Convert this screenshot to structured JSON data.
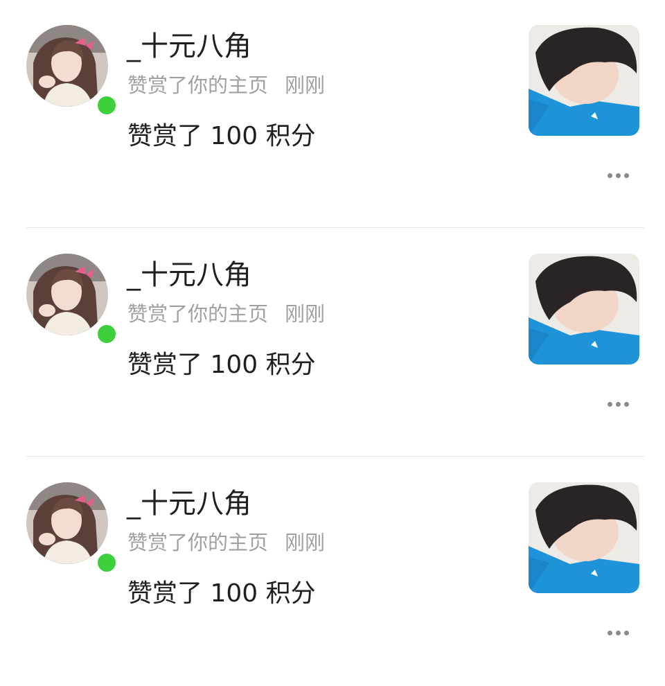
{
  "notifications": [
    {
      "username": "_十元八角",
      "action": "赞赏了你的主页",
      "time": "刚刚",
      "content": "赞赏了 100 积分",
      "avatar_icon": "user-avatar-photo",
      "thumbnail_icon": "profile-photo-thumbnail",
      "online_status_color": "#3ecf3c"
    },
    {
      "username": "_十元八角",
      "action": "赞赏了你的主页",
      "time": "刚刚",
      "content": "赞赏了 100 积分",
      "avatar_icon": "user-avatar-photo",
      "thumbnail_icon": "profile-photo-thumbnail",
      "online_status_color": "#3ecf3c"
    },
    {
      "username": "_十元八角",
      "action": "赞赏了你的主页",
      "time": "刚刚",
      "content": "赞赏了 100 积分",
      "avatar_icon": "user-avatar-photo",
      "thumbnail_icon": "profile-photo-thumbnail",
      "online_status_color": "#3ecf3c"
    }
  ],
  "more_icon": "ellipsis-icon",
  "colors": {
    "text_primary": "#1f1f1f",
    "text_secondary": "#a0a0a0",
    "divider": "#e6e6e6",
    "online": "#3ecf3c"
  }
}
